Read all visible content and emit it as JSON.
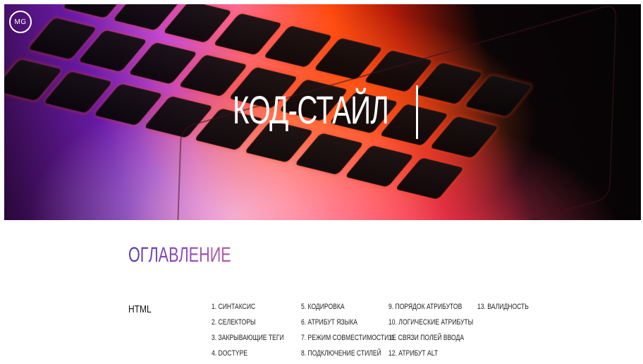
{
  "logo": {
    "text": "MG"
  },
  "hero": {
    "title": "КОД-СТАЙЛ"
  },
  "toc": {
    "title": "ОГЛАВЛЕНИЕ",
    "title_colors": [
      "#5a3fb0",
      "#7a48b4",
      "#9a52b8",
      "#b25aa8"
    ],
    "section": "HTML",
    "columns": [
      [
        "1. СИНТАКСИС",
        "2. СЕЛЕКТОРЫ",
        "3. ЗАКРЫВАЮЩИЕ ТЕГИ",
        "4. DOCTYPE"
      ],
      [
        "5. КОДИРОВКА",
        "6. АТРИБУТ ЯЗЫКА",
        "7. РЕЖИМ СОВМЕСТИМОСТИ IE",
        "8. ПОДКЛЮЧЕНИЕ СТИЛЕЙ"
      ],
      [
        "9. ПОРЯДОК АТРИБУТОВ",
        "10. ЛОГИЧЕСКИЕ АТРИБУТЫ",
        "11. СВЯЗИ ПОЛЕЙ ВВОДА",
        "12. АТРИБУТ ALT"
      ],
      [
        "13. ВАЛИДНОСТЬ"
      ]
    ]
  }
}
